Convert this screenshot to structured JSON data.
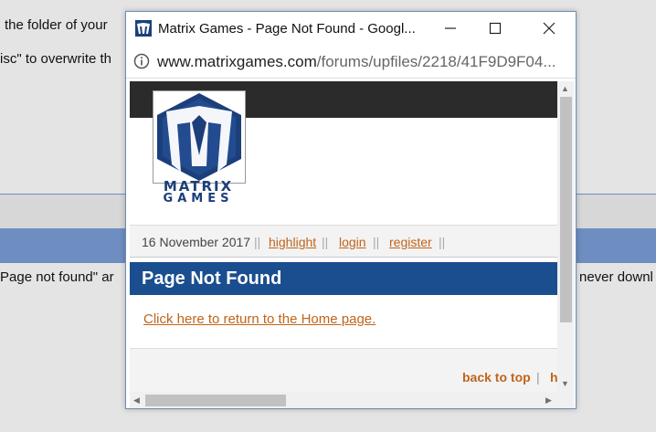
{
  "background": {
    "line1": "the folder of your",
    "line2": "isc\" to overwrite th",
    "line3_left": "Page not found\" ar",
    "line3_right": "never downl"
  },
  "window": {
    "title": "Matrix Games - Page Not Found - Googl...",
    "url_domain": "www.matrixgames.com",
    "url_path": "/forums/upfiles/2218/41F9D9F04..."
  },
  "page": {
    "logo_line1": "MATRIX",
    "logo_line2": "GAMES",
    "date": "16 November 2017",
    "nav": [
      "highlight",
      "login",
      "register"
    ],
    "separator": "||",
    "heading": "Page Not Found",
    "home_link": "Click here to return to the Home page.",
    "footer_back": "back to top",
    "footer_pipe": "|",
    "footer_cut": "h"
  },
  "colors": {
    "header_blue": "#1a4e8f",
    "link_orange": "#c0641a",
    "dark_band": "#2b2b2b"
  }
}
